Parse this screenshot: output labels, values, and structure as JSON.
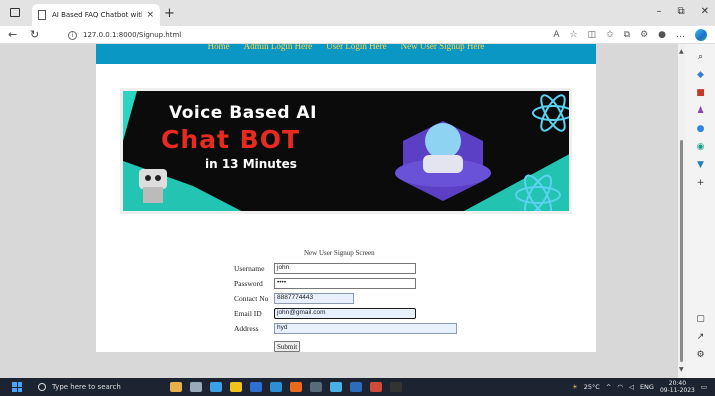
{
  "browser": {
    "tab_title": "AI Based FAQ Chatbot with Voic",
    "tab_close": "×",
    "new_tab": "+",
    "url": "127.0.0.1:8000/Signup.html",
    "win_minimize": "–",
    "win_restore": "⧉",
    "win_close": "✕"
  },
  "nav": {
    "links": [
      "Home",
      "Admin Login Here",
      "User Login Here",
      "New User Signup Here"
    ]
  },
  "banner": {
    "line1": "Voice Based AI",
    "line2": "Chat BOT",
    "line3": "in 13 Minutes"
  },
  "form": {
    "heading": "New User Signup Screen",
    "fields": [
      {
        "label": "Username",
        "value": "john"
      },
      {
        "label": "Password",
        "value": "••••"
      },
      {
        "label": "Contact No",
        "value": "8887774443"
      },
      {
        "label": "Email ID",
        "value": "john@gmail.com"
      },
      {
        "label": "Address",
        "value": "hyd"
      }
    ],
    "submit_label": "Submit"
  },
  "taskbar": {
    "search_placeholder": "Type here to search",
    "weather": "25°C",
    "language": "ENG",
    "time": "20:40",
    "date": "09-11-2023"
  },
  "colors": {
    "navbar_bg": "#0b97c3",
    "nav_link": "#ffd84a",
    "banner_red": "#e82a20"
  }
}
